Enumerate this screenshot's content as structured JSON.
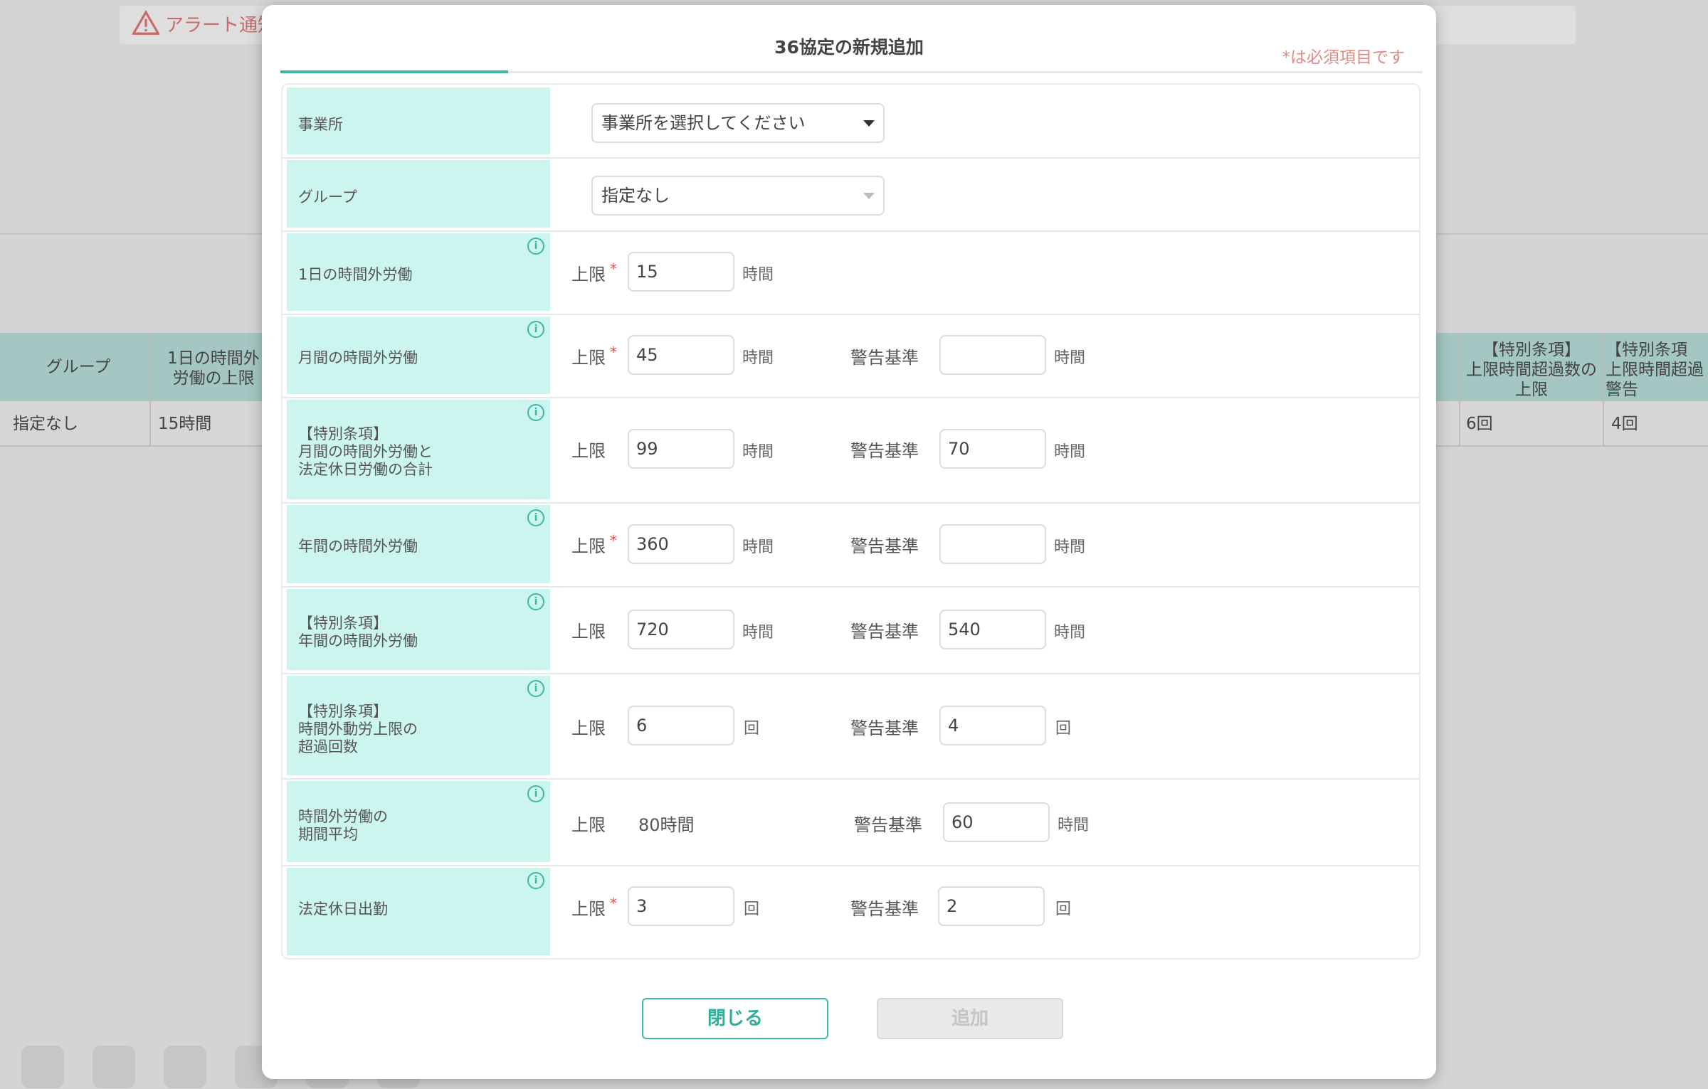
{
  "background": {
    "alert_label": "アラート通知",
    "table_headers": [
      "グループ",
      "1日の時間外\n労働の上限",
      "【特別条項】\n上限時間超過数の\n上限",
      "【特別条項\n上限時間超過\n警告"
    ],
    "table_row": [
      "指定なし",
      "15時間",
      "6回",
      "4回"
    ]
  },
  "modal": {
    "title": "36協定の新規追加",
    "required_note": "*は必須項目です"
  },
  "rows": {
    "office": {
      "label": "事業所",
      "select_value": "事業所を選択してください"
    },
    "group": {
      "label": "グループ",
      "select_value": "指定なし"
    },
    "daily": {
      "label": "1日の時間外労働",
      "limit_label": "上限",
      "limit_value": "15",
      "unit": "時間"
    },
    "monthly": {
      "label": "月間の時間外労働",
      "limit_label": "上限",
      "limit_value": "45",
      "unit": "時間",
      "warn_label": "警告基準",
      "warn_value": "",
      "warn_unit": "時間"
    },
    "special_monthly_total": {
      "label": "【特別条項】\n月間の時間外労働と\n法定休日労働の合計",
      "limit_label": "上限",
      "limit_value": "99",
      "unit": "時間",
      "warn_label": "警告基準",
      "warn_value": "70",
      "warn_unit": "時間"
    },
    "annual": {
      "label": "年間の時間外労働",
      "limit_label": "上限",
      "limit_value": "360",
      "unit": "時間",
      "warn_label": "警告基準",
      "warn_value": "",
      "warn_unit": "時間"
    },
    "special_annual": {
      "label": "【特別条項】\n年間の時間外労働",
      "limit_label": "上限",
      "limit_value": "720",
      "unit": "時間",
      "warn_label": "警告基準",
      "warn_value": "540",
      "warn_unit": "時間"
    },
    "special_exceed_count": {
      "label": "【特別条項】\n時間外動労上限の\n超過回数",
      "limit_label": "上限",
      "limit_value": "6",
      "unit": "回",
      "warn_label": "警告基準",
      "warn_value": "4",
      "warn_unit": "回"
    },
    "period_average": {
      "label": "時間外労働の\n期間平均",
      "limit_label": "上限",
      "limit_static": "80時間",
      "warn_label": "警告基準",
      "warn_value": "60",
      "warn_unit": "時間"
    },
    "holiday_work": {
      "label": "法定休日出勤",
      "limit_label": "上限",
      "limit_value": "3",
      "unit": "回",
      "warn_label": "警告基準",
      "warn_value": "2",
      "warn_unit": "回"
    }
  },
  "required_mark": "*",
  "info_icon_glyph": "i",
  "buttons": {
    "close": "閉じる",
    "add": "追加"
  },
  "colors": {
    "accent": "#3fb7a6",
    "label_bg": "#cdf5ef",
    "required": "#e05050"
  }
}
